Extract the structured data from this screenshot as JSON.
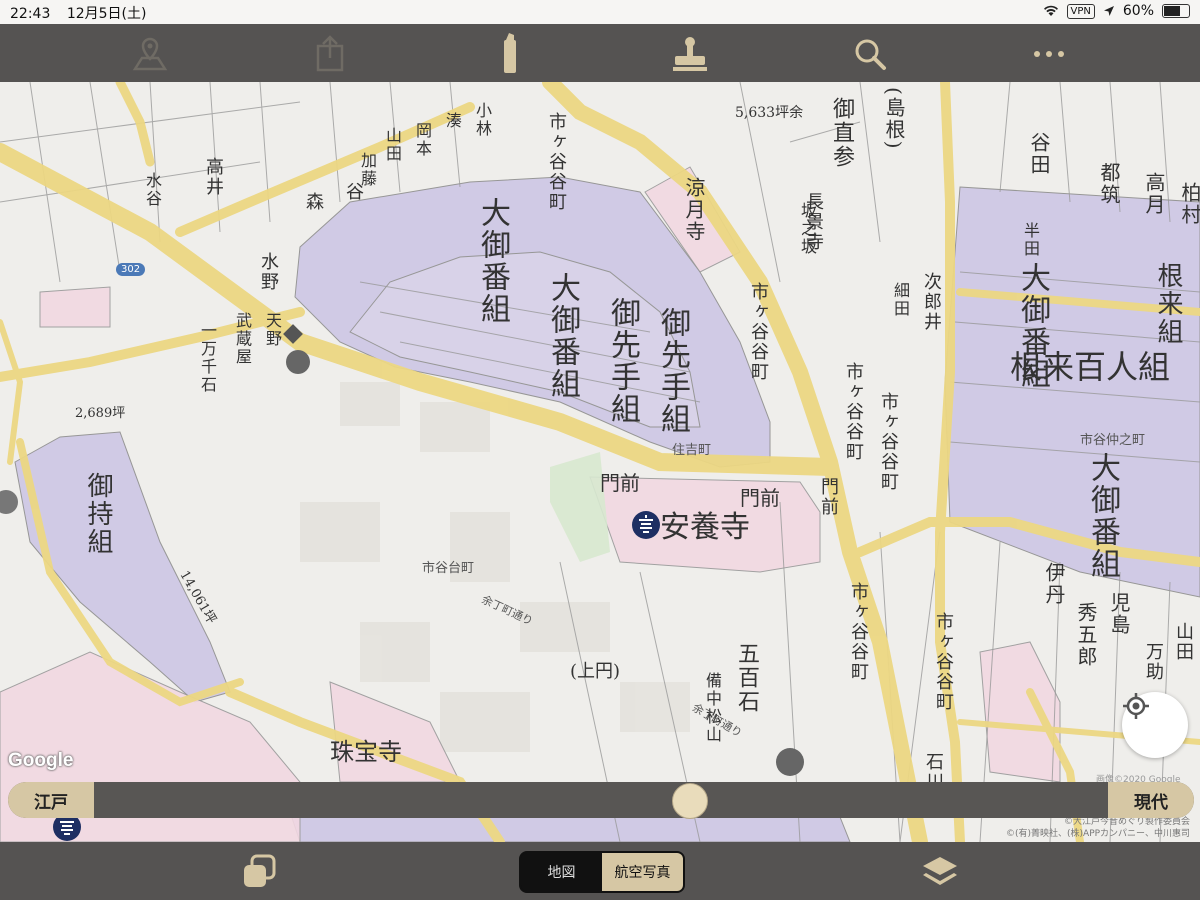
{
  "status_bar": {
    "time": "22:43",
    "date": "12月5日(土)",
    "vpn": "VPN",
    "battery": "60%"
  },
  "toolbar": {
    "icons": [
      "map-pin-icon",
      "share-icon",
      "marker-icon",
      "stamp-icon",
      "search-icon",
      "more-icon"
    ]
  },
  "map": {
    "google_logo": "Google",
    "copyright": "画像©2020 Google",
    "credits": [
      "©大江戸今昔めぐり製作委員会",
      "©(有)菁映社、(株)APPカンパニー、中川惠司"
    ],
    "route_badge": "302",
    "modern_labels": [
      "住吉町",
      "市谷台町",
      "市谷仲之町",
      "余丁町通り",
      "余丁町通り"
    ],
    "historic_labels": [
      "大御番組",
      "大御番組",
      "御先手組",
      "御先手組",
      "御持組",
      "大御番組",
      "大御番組",
      "根来百人組",
      "根来組",
      "市ヶ谷谷町",
      "市ヶ谷谷町",
      "市ヶ谷谷町",
      "市ヶ谷谷町",
      "市ヶ谷谷町",
      "市ヶ谷谷町",
      "安養寺",
      "門前",
      "門前",
      "門前",
      "涼月寺",
      "石川",
      "伊丹",
      "児島",
      "秀五郎",
      "山田",
      "万助",
      "谷田",
      "都筑",
      "高月",
      "柏村",
      "長景寺",
      "御直参",
      "(島根)",
      "5,633坪余",
      "2,689坪",
      "14,061坪",
      "珠宝寺",
      "武蔵屋",
      "五百石",
      "一万千石",
      "(上円)",
      "備中松山",
      "高井",
      "森",
      "谷",
      "水野",
      "小林",
      "湊",
      "岡本",
      "山田",
      "加藤",
      "天野",
      "坂之坂",
      "次郎井",
      "細田",
      "半田",
      "水谷"
    ]
  },
  "slider": {
    "left_label": "江戸",
    "right_label": "現代",
    "position": 0.59
  },
  "bottom_bar": {
    "layers_icon": "layers-icon",
    "copy_icon": "overlay-icon",
    "segment": [
      "地図",
      "航空写真"
    ],
    "selected": "航空写真"
  }
}
